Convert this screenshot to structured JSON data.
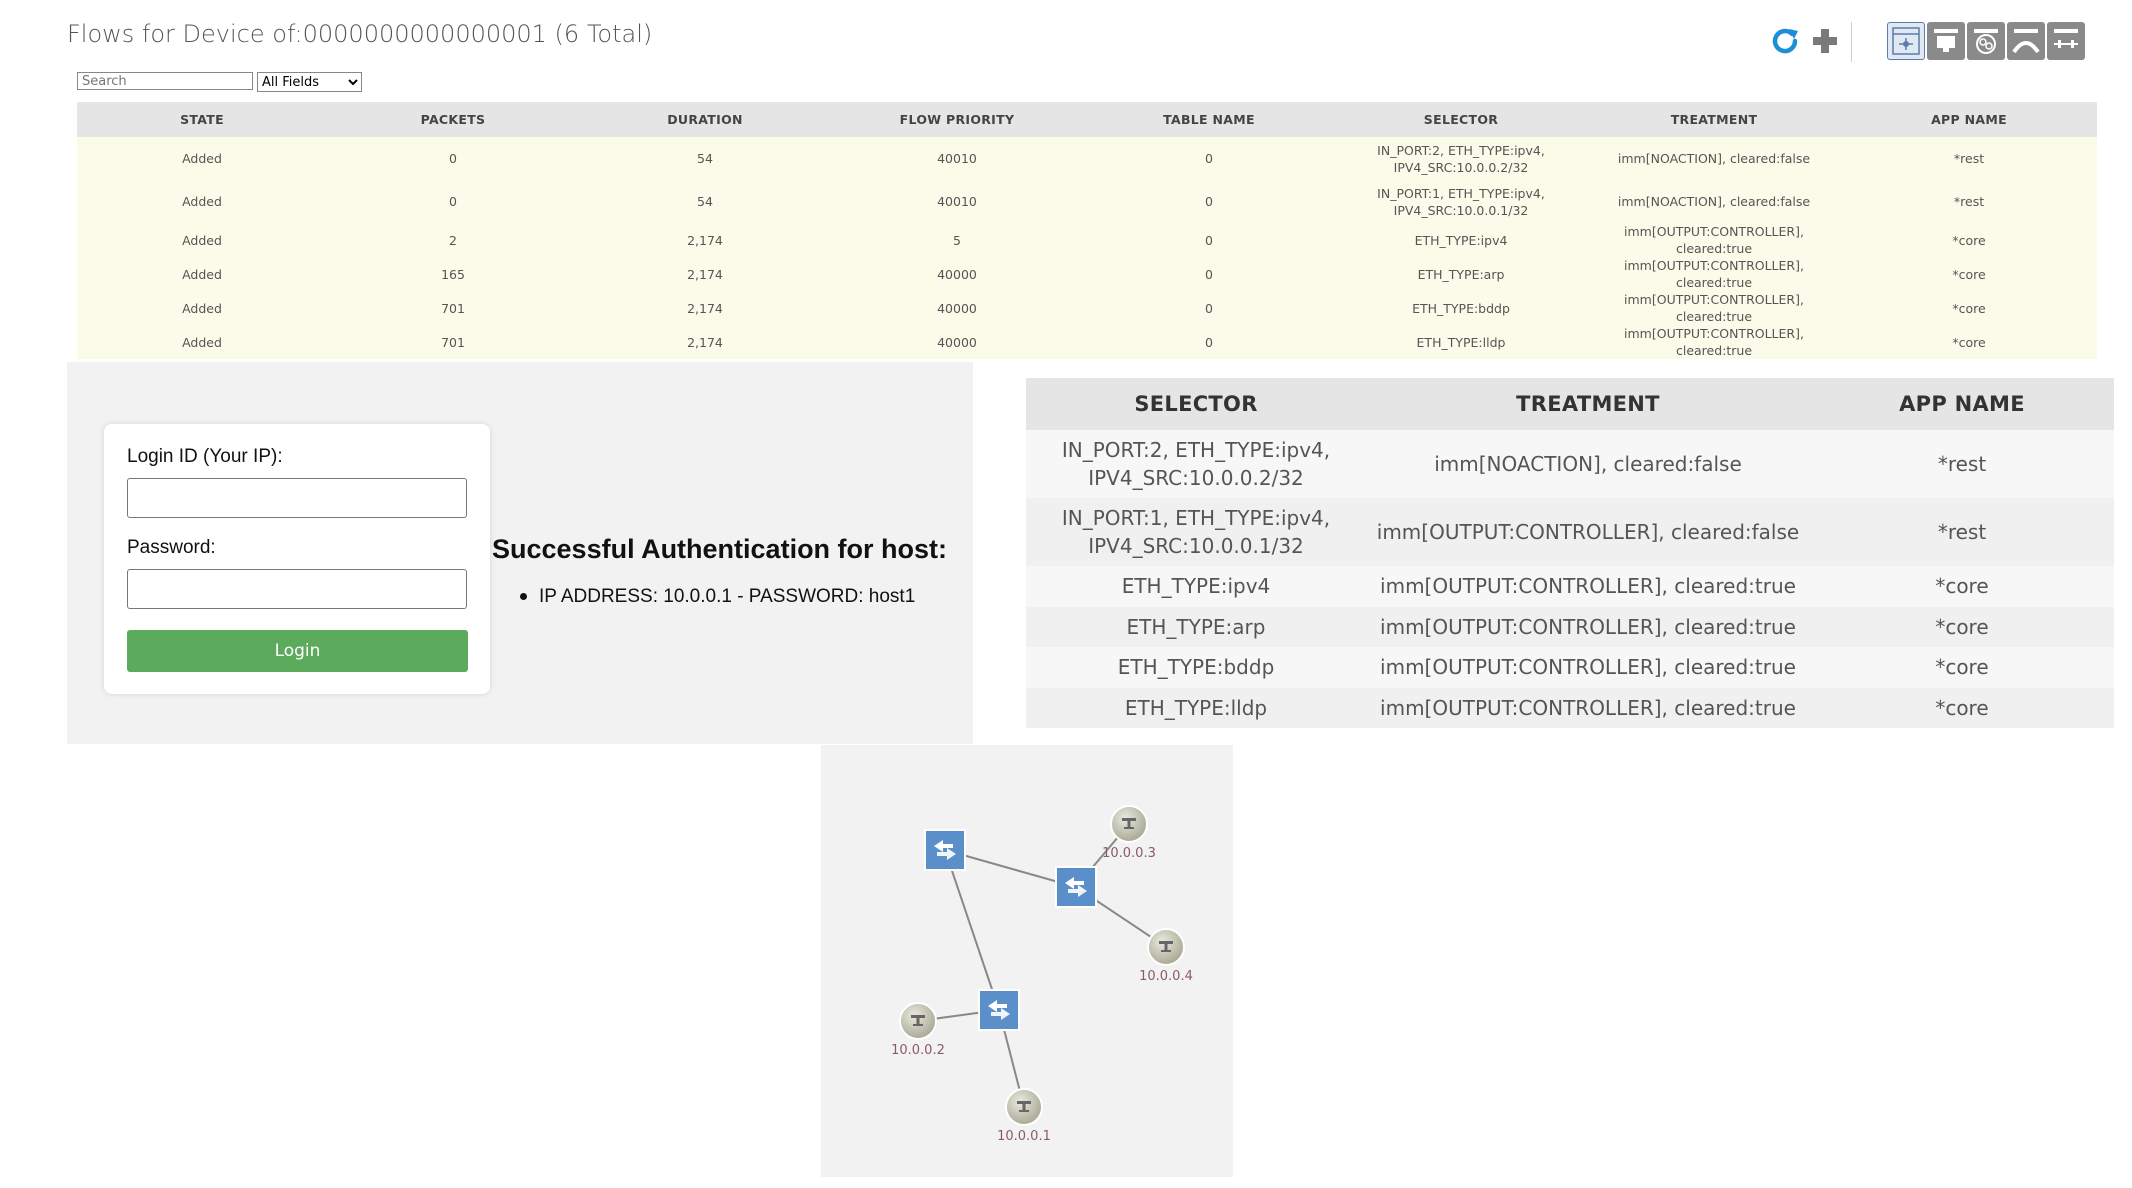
{
  "header": {
    "title": "Flows for Device of:0000000000000001 (6 Total)"
  },
  "toolbar": {
    "refresh_icon": "refresh-icon",
    "add_icon": "plus-icon",
    "views": [
      "topology-view",
      "device-view",
      "flow-view",
      "port-view",
      "group-view"
    ]
  },
  "search": {
    "placeholder": "Search",
    "field_selected": "All Fields"
  },
  "flow_table": {
    "headers": [
      "STATE",
      "PACKETS",
      "DURATION",
      "FLOW PRIORITY",
      "TABLE NAME",
      "SELECTOR",
      "TREATMENT",
      "APP NAME"
    ],
    "rows": [
      {
        "state": "Added",
        "packets": "0",
        "duration": "54",
        "priority": "40010",
        "table": "0",
        "selector_l1": "IN_PORT:2, ETH_TYPE:ipv4,",
        "selector_l2": "IPV4_SRC:10.0.0.2/32",
        "treatment": "imm[NOACTION], cleared:false",
        "app": "*rest"
      },
      {
        "state": "Added",
        "packets": "0",
        "duration": "54",
        "priority": "40010",
        "table": "0",
        "selector_l1": "IN_PORT:1, ETH_TYPE:ipv4,",
        "selector_l2": "IPV4_SRC:10.0.0.1/32",
        "treatment": "imm[NOACTION], cleared:false",
        "app": "*rest"
      },
      {
        "state": "Added",
        "packets": "2",
        "duration": "2,174",
        "priority": "5",
        "table": "0",
        "selector_l1": "ETH_TYPE:ipv4",
        "selector_l2": "",
        "treatment": "imm[OUTPUT:CONTROLLER], cleared:true",
        "app": "*core"
      },
      {
        "state": "Added",
        "packets": "165",
        "duration": "2,174",
        "priority": "40000",
        "table": "0",
        "selector_l1": "ETH_TYPE:arp",
        "selector_l2": "",
        "treatment": "imm[OUTPUT:CONTROLLER], cleared:true",
        "app": "*core"
      },
      {
        "state": "Added",
        "packets": "701",
        "duration": "2,174",
        "priority": "40000",
        "table": "0",
        "selector_l1": "ETH_TYPE:bddp",
        "selector_l2": "",
        "treatment": "imm[OUTPUT:CONTROLLER], cleared:true",
        "app": "*core"
      },
      {
        "state": "Added",
        "packets": "701",
        "duration": "2,174",
        "priority": "40000",
        "table": "0",
        "selector_l1": "ETH_TYPE:lldp",
        "selector_l2": "",
        "treatment": "imm[OUTPUT:CONTROLLER], cleared:true",
        "app": "*core"
      }
    ]
  },
  "login": {
    "id_label": "Login ID (Your IP):",
    "password_label": "Password:",
    "id_value": "",
    "password_value": "",
    "button": "Login"
  },
  "auth": {
    "heading": "Successful Authentication for host:",
    "item": "IP ADDRESS: 10.0.0.1 - PASSWORD: host1"
  },
  "zoom_table": {
    "headers": [
      "SELECTOR",
      "TREATMENT",
      "APP NAME"
    ],
    "rows": [
      {
        "selector_l1": "IN_PORT:2, ETH_TYPE:ipv4,",
        "selector_l2": "IPV4_SRC:10.0.0.2/32",
        "treatment": "imm[NOACTION], cleared:false",
        "app": "*rest"
      },
      {
        "selector_l1": "IN_PORT:1, ETH_TYPE:ipv4,",
        "selector_l2": "IPV4_SRC:10.0.0.1/32",
        "treatment": "imm[OUTPUT:CONTROLLER], cleared:false",
        "app": "*rest"
      },
      {
        "selector_l1": "ETH_TYPE:ipv4",
        "selector_l2": "",
        "treatment": "imm[OUTPUT:CONTROLLER], cleared:true",
        "app": "*core"
      },
      {
        "selector_l1": "ETH_TYPE:arp",
        "selector_l2": "",
        "treatment": "imm[OUTPUT:CONTROLLER], cleared:true",
        "app": "*core"
      },
      {
        "selector_l1": "ETH_TYPE:bddp",
        "selector_l2": "",
        "treatment": "imm[OUTPUT:CONTROLLER], cleared:true",
        "app": "*core"
      },
      {
        "selector_l1": "ETH_TYPE:lldp",
        "selector_l2": "",
        "treatment": "imm[OUTPUT:CONTROLLER], cleared:true",
        "app": "*core"
      }
    ]
  },
  "topology": {
    "hosts": [
      "10.0.0.3",
      "10.0.0.4",
      "10.0.0.2",
      "10.0.0.1"
    ],
    "switch_color": "#5b8fc9",
    "host_color": "#b9b9a6"
  }
}
